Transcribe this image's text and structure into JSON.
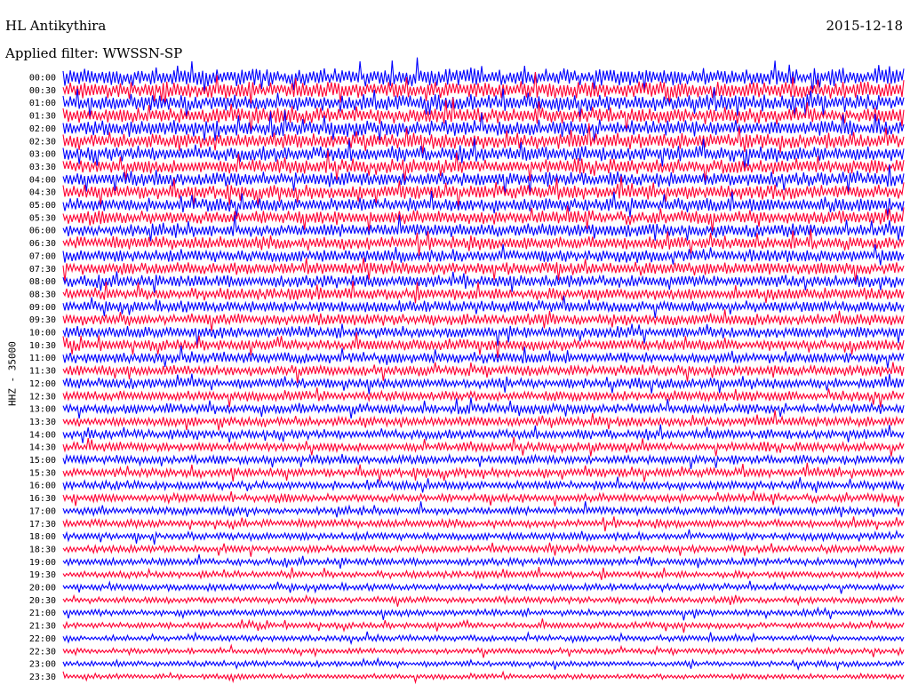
{
  "header": {
    "station": "HL Antikythira",
    "date": "2015-12-18",
    "filter": "Applied filter: WWSSN-SP"
  },
  "chart_data": {
    "type": "line",
    "title": "HL Antikythira",
    "ylabel": "HHZ - 35000",
    "y_ticks": [
      "00:00",
      "00:30",
      "01:00",
      "01:30",
      "02:00",
      "02:30",
      "03:00",
      "03:30",
      "04:00",
      "04:30",
      "05:00",
      "05:30",
      "06:00",
      "06:30",
      "07:00",
      "07:30",
      "08:00",
      "08:30",
      "09:00",
      "09:30",
      "10:00",
      "10:30",
      "11:00",
      "11:30",
      "12:00",
      "12:30",
      "13:00",
      "13:30",
      "14:00",
      "14:30",
      "15:00",
      "15:30",
      "16:00",
      "16:30",
      "17:00",
      "17:30",
      "18:00",
      "18:30",
      "19:00",
      "19:30",
      "20:00",
      "20:30",
      "21:00",
      "21:30",
      "22:00",
      "22:30",
      "23:00",
      "23:30"
    ],
    "trace_colors": [
      "#0000ff",
      "#ff0033"
    ],
    "grid": false,
    "legend": "none"
  }
}
